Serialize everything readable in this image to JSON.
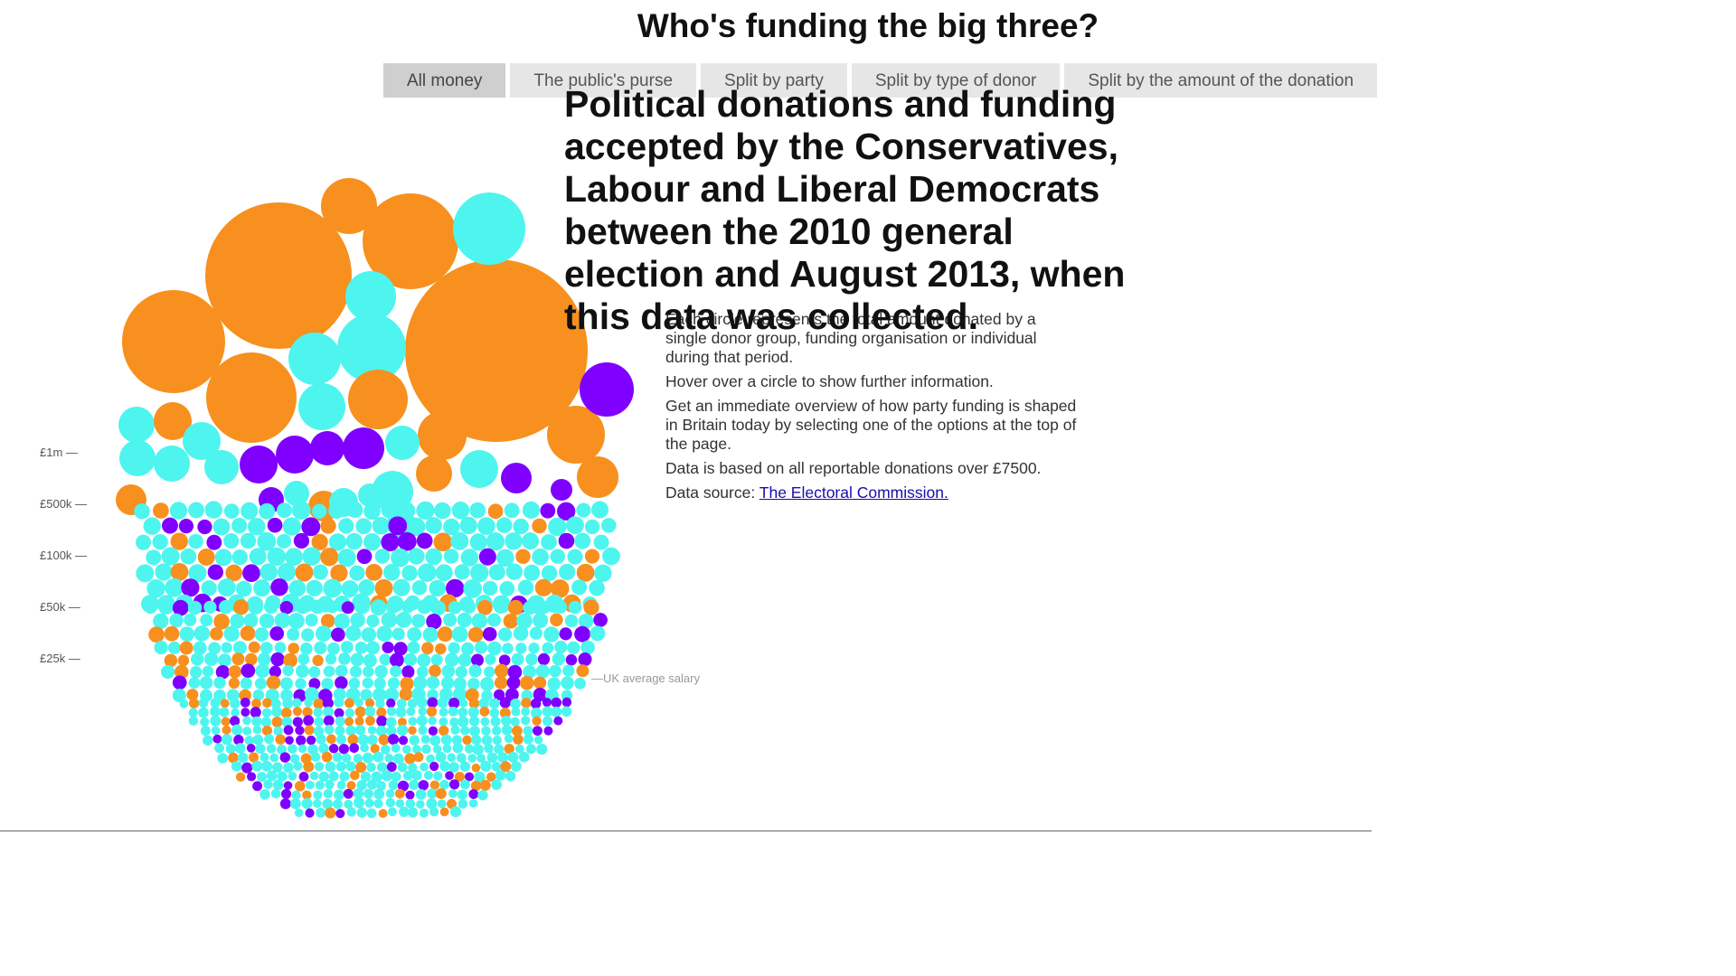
{
  "header": {
    "title": "Who's funding the big three?"
  },
  "tabs": [
    {
      "label": "All money",
      "active": true
    },
    {
      "label": "The public's purse",
      "active": false
    },
    {
      "label": "Split by party",
      "active": false
    },
    {
      "label": "Split by type of donor",
      "active": false
    },
    {
      "label": "Split by the amount of the donation",
      "active": false
    }
  ],
  "headline": "Political donations and funding accepted by the Conservatives, Labour and Liberal Democrats between the 2010 general election and August 2013, when this data was collected.",
  "intro": {
    "p1": "Each circle represents the total amount donated by a single donor group, funding organisation or individual during that period.",
    "p2": "Hover over a circle to show further information.",
    "p3": "Get an immediate overview of how party funding is shaped in Britain today by selecting one of the options at the top of the page.",
    "p4": "Data is based on all reportable donations over £7500.",
    "p5_prefix": "Data source: ",
    "p5_link": "The Electoral Commission."
  },
  "colors": {
    "orange": "#f7901e",
    "cyan": "#4ef5ef",
    "purple": "#7f00ff"
  },
  "chart_data": {
    "type": "bubble-scale",
    "title": "",
    "axis": {
      "ticks": [
        {
          "label": "£1m —",
          "value": 1000000
        },
        {
          "label": "£500k —",
          "value": 500000
        },
        {
          "label": "£100k —",
          "value": 100000
        },
        {
          "label": "£50k —",
          "value": 50000
        },
        {
          "label": "£25k —",
          "value": 25000
        }
      ],
      "reference": {
        "label": "—UK average salary",
        "value": 26000
      }
    },
    "series": [
      {
        "color": "#f7901e"
      },
      {
        "color": "#4ef5ef"
      },
      {
        "color": "#7f00ff"
      }
    ]
  }
}
